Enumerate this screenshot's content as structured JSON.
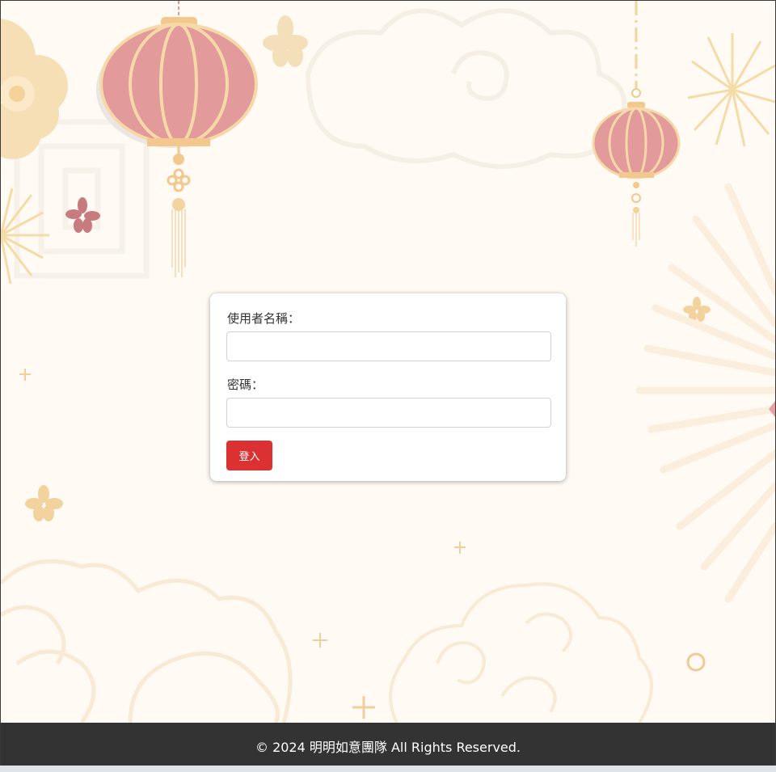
{
  "login_form": {
    "username_label": "使用者名稱：",
    "username_value": "",
    "password_label": "密碼：",
    "password_value": "",
    "submit_label": "登入"
  },
  "footer": {
    "copyright": "© 2024 明明如意團隊 All Rights Reserved."
  },
  "colors": {
    "background": "#fffaf3",
    "lantern": "#e39a9a",
    "gold": "#f3d9a8",
    "button": "#dc3132",
    "footer": "#333333"
  },
  "decor": {
    "icons": [
      "lantern-icon",
      "flower-icon",
      "firework-icon",
      "cloud-icon",
      "sparkle-icon",
      "ring-icon"
    ]
  }
}
